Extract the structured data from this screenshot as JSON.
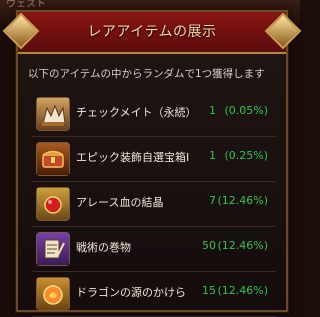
{
  "background": {
    "text": "ウェスト"
  },
  "dialog": {
    "title": "レアアイテムの展示",
    "subtitle": "以下のアイテムの中からランダムで1つ獲得します"
  },
  "items": [
    {
      "name": "チェックメイト（永続）",
      "qty": "1",
      "rate": "(0.05%)",
      "icon": "checkmate-icon"
    },
    {
      "name": "エピック装飾自選宝箱Ⅰ",
      "qty": "1",
      "rate": "(0.25%)",
      "icon": "treasure-chest-icon"
    },
    {
      "name": "アレース血の結晶",
      "qty": "7",
      "rate": "(12.46%)",
      "icon": "blood-crystal-icon"
    },
    {
      "name": "戦術の巻物",
      "qty": "50",
      "rate": "(12.46%)",
      "icon": "scroll-icon"
    },
    {
      "name": "ドラゴンの源のかけら",
      "qty": "15",
      "rate": "(12.46%)",
      "icon": "dragon-shard-icon"
    }
  ],
  "colors": {
    "accent_green": "#29c742",
    "header_red": "#7a1212",
    "gold": "#b08a3e"
  }
}
